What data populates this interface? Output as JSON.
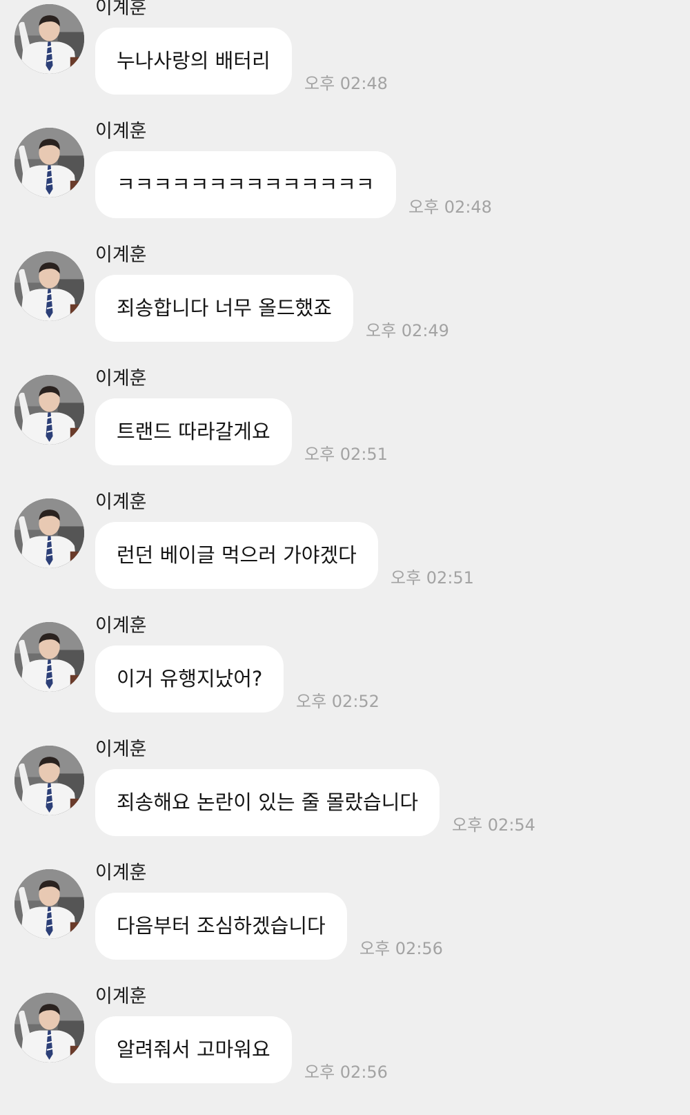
{
  "messages": [
    {
      "sender": "이계훈",
      "text": "누나사랑의 배터리",
      "time": "오후 02:48"
    },
    {
      "sender": "이계훈",
      "text": "ㅋㅋㅋㅋㅋㅋㅋㅋㅋㅋㅋㅋㅋㅋ",
      "time": "오후 02:48"
    },
    {
      "sender": "이계훈",
      "text": "죄송합니다 너무 올드했죠",
      "time": "오후 02:49"
    },
    {
      "sender": "이계훈",
      "text": "트랜드 따라갈게요",
      "time": "오후 02:51"
    },
    {
      "sender": "이계훈",
      "text": "런던 베이글 먹으러 가야겠다",
      "time": "오후 02:51"
    },
    {
      "sender": "이계훈",
      "text": "이거 유행지났어?",
      "time": "오후 02:52"
    },
    {
      "sender": "이계훈",
      "text": "죄송해요 논란이 있는 줄 몰랐습니다",
      "time": "오후 02:54"
    },
    {
      "sender": "이계훈",
      "text": "다음부터 조심하겠습니다",
      "time": "오후 02:56"
    },
    {
      "sender": "이계훈",
      "text": "알려줘서 고마워요",
      "time": "오후 02:56"
    }
  ],
  "avatar_icon": "profile-photo-icon",
  "colors": {
    "background": "#efefef",
    "bubble": "#ffffff",
    "timestamp": "#a3a3a3",
    "text": "#151515"
  }
}
